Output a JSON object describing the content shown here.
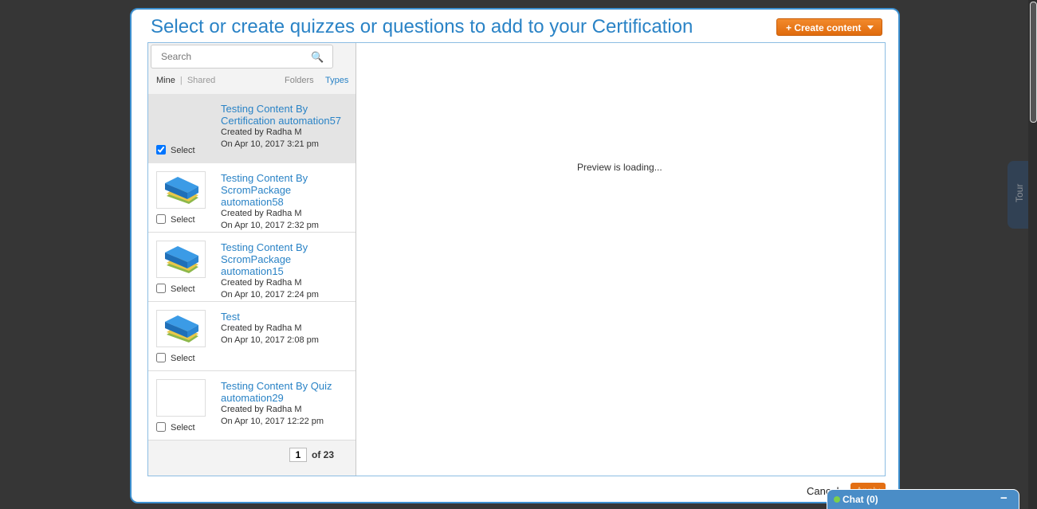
{
  "modal": {
    "title": "Select or create quizzes or questions to add to your Certification",
    "create_button": "+ Create content"
  },
  "search": {
    "placeholder": "Search",
    "icon": "search-icon"
  },
  "filters": {
    "mine": "Mine",
    "separator": "|",
    "shared": "Shared",
    "folders": "Folders",
    "types": "Types"
  },
  "items": [
    {
      "title": "Testing Content By Certification automation57",
      "created_by": "Created by Radha M",
      "date": "On Apr 10, 2017 3:21 pm",
      "select_label": "Select",
      "checked": true,
      "thumbnail": "none"
    },
    {
      "title": "Testing Content By ScromPackage automation58",
      "created_by": "Created by Radha M",
      "date": "On Apr 10, 2017 2:32 pm",
      "select_label": "Select",
      "checked": false,
      "thumbnail": "books-icon"
    },
    {
      "title": "Testing Content By ScromPackage automation15",
      "created_by": "Created by Radha M",
      "date": "On Apr 10, 2017 2:24 pm",
      "select_label": "Select",
      "checked": false,
      "thumbnail": "books-icon"
    },
    {
      "title": "Test",
      "created_by": "Created by Radha M",
      "date": "On Apr 10, 2017 2:08 pm",
      "select_label": "Select",
      "checked": false,
      "thumbnail": "books-icon"
    },
    {
      "title": "Testing Content By Quiz automation29",
      "created_by": "Created by Radha M",
      "date": "On Apr 10, 2017 12:22 pm",
      "select_label": "Select",
      "checked": false,
      "thumbnail": "blank"
    }
  ],
  "pager": {
    "current": "1",
    "total": "of 23"
  },
  "preview": {
    "text": "Preview is loading..."
  },
  "footer": {
    "cancel": "Cancel",
    "apply": "Apply"
  },
  "chat": {
    "label": "Chat  (0)",
    "minimize": "−"
  },
  "tour": {
    "label": "Tour"
  },
  "colors": {
    "accent": "#2a83c6",
    "primary_button": "#e36f13",
    "chat_bar": "#4a8dc7"
  }
}
